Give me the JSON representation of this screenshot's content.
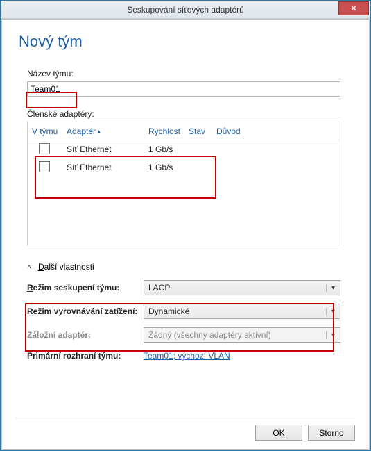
{
  "window": {
    "title": "Seskupování síťových adaptérů",
    "close_icon": "✕"
  },
  "heading": "Nový tým",
  "team": {
    "name_label": "Název týmu:",
    "name_value": "Team01"
  },
  "members": {
    "label": "Členské adaptéry:",
    "columns": {
      "in_team": "V týmu",
      "adapter": "Adaptér",
      "speed": "Rychlost",
      "state": "Stav",
      "reason": "Důvod"
    },
    "rows": [
      {
        "checked": false,
        "adapter": "Síť Ethernet",
        "speed": "1 Gb/s",
        "state": "",
        "reason": ""
      },
      {
        "checked": false,
        "adapter": "Síť Ethernet",
        "speed": "1 Gb/s",
        "state": "",
        "reason": ""
      }
    ]
  },
  "more": {
    "expander_label": "Další vlastnosti",
    "expander_accel": "D",
    "teaming_mode_label_pre": "R",
    "teaming_mode_label": "ežim seskupení týmu:",
    "teaming_mode_value": "LACP",
    "balancing_label_pre": "R",
    "balancing_label": "ežim vyrovnávání zatížení:",
    "balancing_value": "Dynamické",
    "standby_label": "Záložní adaptér:",
    "standby_value": "Žádný (všechny adaptéry aktivní)",
    "primary_label": "Primární rozhraní týmu:",
    "primary_value": "Team01; výchozí VLAN"
  },
  "buttons": {
    "ok": "OK",
    "cancel": "Storno"
  }
}
